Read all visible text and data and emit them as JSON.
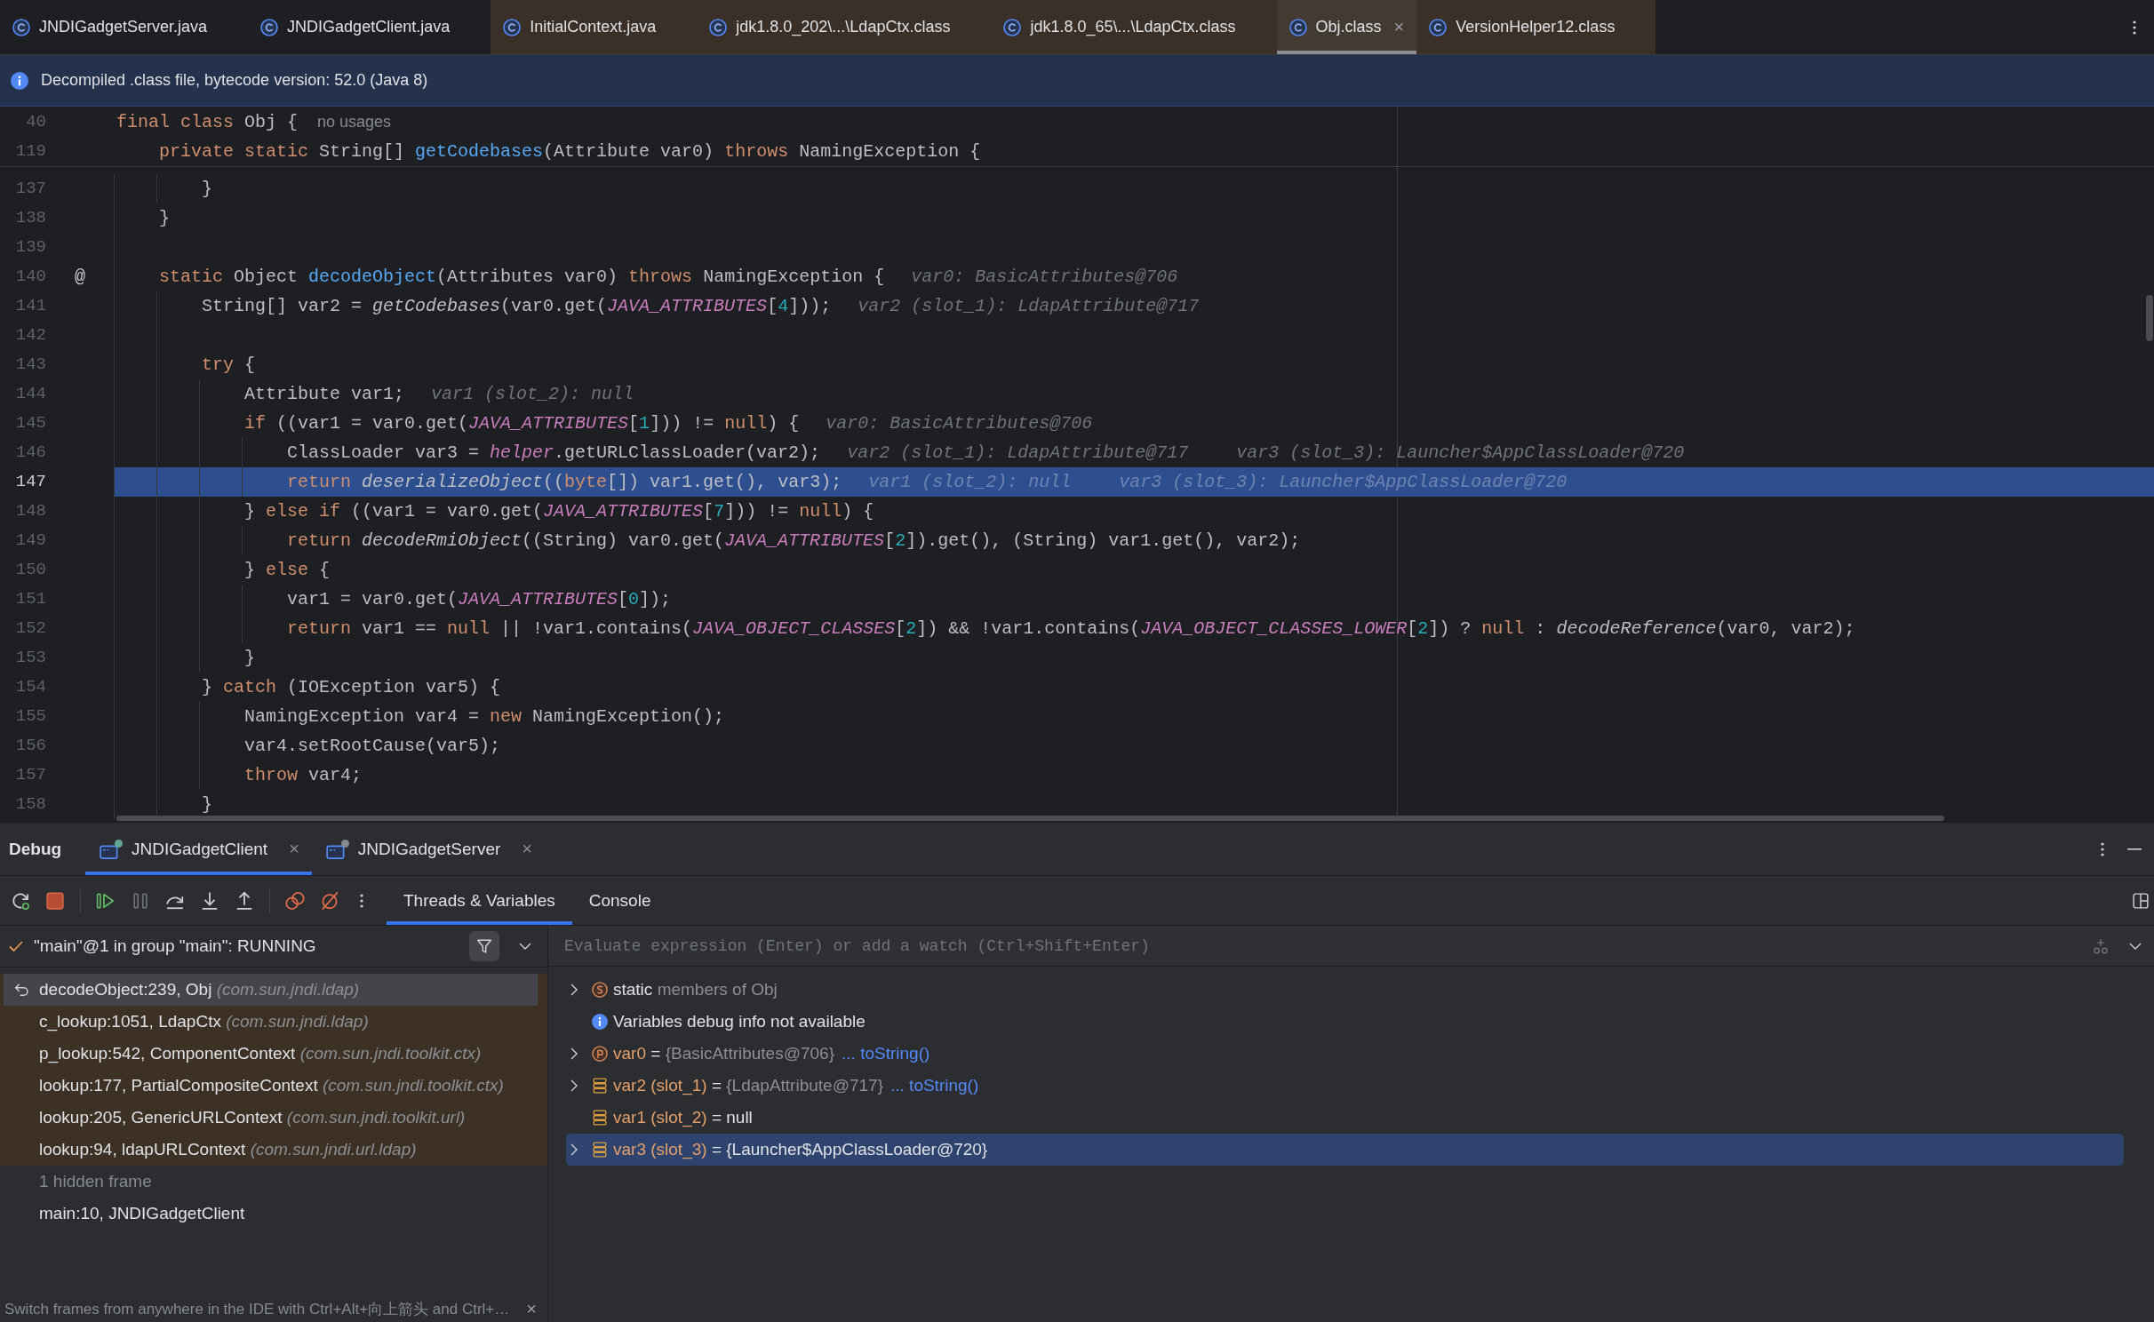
{
  "editor_tabs": [
    {
      "label": "JNDIGadgetServer.java",
      "library": false,
      "selected": false
    },
    {
      "label": "JNDIGadgetClient.java",
      "library": false,
      "selected": false
    },
    {
      "label": "InitialContext.java",
      "library": true,
      "selected": false
    },
    {
      "label": "jdk1.8.0_202\\...\\LdapCtx.class",
      "library": true,
      "selected": false
    },
    {
      "label": "jdk1.8.0_65\\...\\LdapCtx.class",
      "library": true,
      "selected": false
    },
    {
      "label": "Obj.class",
      "library": true,
      "selected": true,
      "close": "×"
    },
    {
      "label": "VersionHelper12.class",
      "library": true,
      "selected": false
    }
  ],
  "notification": {
    "text": "Decompiled .class file, bytecode version: 52.0 (Java 8)"
  },
  "editor": {
    "lines": [
      {
        "number": "40",
        "current": false,
        "tokens": [
          {
            "kind": "keyword",
            "text": "final class"
          },
          {
            "kind": "plain",
            "text": " Obj {"
          }
        ],
        "hints": [
          {
            "kind": "usages",
            "text": "no usages"
          }
        ],
        "children": [
          {
            "number": "119",
            "current": false,
            "tokens": [
              {
                "kind": "keyword",
                "text": "private static"
              },
              {
                "kind": "plain",
                "text": " String[] "
              },
              {
                "kind": "declaration",
                "text": "getCodebases"
              },
              {
                "kind": "plain",
                "text": "(Attribute var0) "
              },
              {
                "kind": "keyword",
                "text": "throws"
              },
              {
                "kind": "plain",
                "text": " NamingException {"
              }
            ],
            "children": [
              {
                "number": "137",
                "current": false,
                "tokens": [
                  {
                    "kind": "plain",
                    "text": "}"
                  }
                ]
              }
            ]
          },
          {
            "number": "138",
            "current": false,
            "tokens": [
              {
                "kind": "plain",
                "text": "}"
              }
            ]
          },
          {
            "number": "139",
            "current": false
          },
          {
            "number": "140",
            "current": false,
            "gutter_mark": "@",
            "tokens": [
              {
                "kind": "keyword",
                "text": "static"
              },
              {
                "kind": "plain",
                "text": " Object "
              },
              {
                "kind": "declaration",
                "text": "decodeObject"
              },
              {
                "kind": "plain",
                "text": "(Attributes var0) "
              },
              {
                "kind": "keyword",
                "text": "throws"
              },
              {
                "kind": "plain",
                "text": " NamingException {"
              }
            ],
            "hints": [
              {
                "kind": "value",
                "text": "var0: BasicAttributes@706"
              }
            ],
            "children": [
              {
                "number": "141",
                "current": false,
                "tokens": [
                  {
                    "kind": "plain",
                    "text": "String[] var2 = "
                  },
                  {
                    "kind": "static_call",
                    "text": "getCodebases"
                  },
                  {
                    "kind": "plain",
                    "text": "(var0.get("
                  },
                  {
                    "kind": "constant",
                    "text": "JAVA_ATTRIBUTES"
                  },
                  {
                    "kind": "plain",
                    "text": "["
                  },
                  {
                    "kind": "number",
                    "text": "4"
                  },
                  {
                    "kind": "plain",
                    "text": "]));"
                  }
                ],
                "hints": [
                  {
                    "kind": "value",
                    "text": "var2 (slot_1): LdapAttribute@717"
                  }
                ]
              },
              {
                "number": "142",
                "current": false
              },
              {
                "number": "143",
                "current": false,
                "tokens": [
                  {
                    "kind": "keyword",
                    "text": "try"
                  },
                  {
                    "kind": "plain",
                    "text": " {"
                  }
                ],
                "children": [
                  {
                    "number": "144",
                    "current": false,
                    "tokens": [
                      {
                        "kind": "plain",
                        "text": "Attribute var1;"
                      }
                    ],
                    "hints": [
                      {
                        "kind": "value",
                        "text": "var1 (slot_2): null"
                      }
                    ]
                  },
                  {
                    "number": "145",
                    "current": false,
                    "tokens": [
                      {
                        "kind": "keyword",
                        "text": "if"
                      },
                      {
                        "kind": "plain",
                        "text": " ((var1 = var0.get("
                      },
                      {
                        "kind": "constant",
                        "text": "JAVA_ATTRIBUTES"
                      },
                      {
                        "kind": "plain",
                        "text": "["
                      },
                      {
                        "kind": "number",
                        "text": "1"
                      },
                      {
                        "kind": "plain",
                        "text": "])) != "
                      },
                      {
                        "kind": "keyword",
                        "text": "null"
                      },
                      {
                        "kind": "plain",
                        "text": ") {"
                      }
                    ],
                    "hints": [
                      {
                        "kind": "value",
                        "text": "var0: BasicAttributes@706"
                      }
                    ],
                    "children": [
                      {
                        "number": "146",
                        "current": false,
                        "tokens": [
                          {
                            "kind": "plain",
                            "text": "ClassLoader var3 = "
                          },
                          {
                            "kind": "field",
                            "text": "helper"
                          },
                          {
                            "kind": "plain",
                            "text": ".getURLClassLoader(var2);"
                          }
                        ],
                        "hints": [
                          {
                            "kind": "value",
                            "text": "var2 (slot_1): LdapAttribute@717"
                          },
                          {
                            "kind": "value",
                            "text": "var3 (slot_3): Launcher$AppClassLoader@720"
                          }
                        ]
                      },
                      {
                        "number": "147",
                        "current": true,
                        "tokens": [
                          {
                            "kind": "keyword",
                            "text": "return "
                          },
                          {
                            "kind": "static_call",
                            "text": "deserializeObject"
                          },
                          {
                            "kind": "plain",
                            "text": "(("
                          },
                          {
                            "kind": "keyword",
                            "text": "byte"
                          },
                          {
                            "kind": "plain",
                            "text": "[]) var1.get(), var3);"
                          }
                        ],
                        "hints": [
                          {
                            "kind": "value",
                            "text": "var1 (slot_2): null"
                          },
                          {
                            "kind": "value",
                            "text": "var3 (slot_3): Launcher$AppClassLoader@720"
                          }
                        ]
                      }
                    ]
                  },
                  {
                    "number": "148",
                    "current": false,
                    "tokens": [
                      {
                        "kind": "plain",
                        "text": "} "
                      },
                      {
                        "kind": "keyword",
                        "text": "else if"
                      },
                      {
                        "kind": "plain",
                        "text": " ((var1 = var0.get("
                      },
                      {
                        "kind": "constant",
                        "text": "JAVA_ATTRIBUTES"
                      },
                      {
                        "kind": "plain",
                        "text": "["
                      },
                      {
                        "kind": "number",
                        "text": "7"
                      },
                      {
                        "kind": "plain",
                        "text": "])) != "
                      },
                      {
                        "kind": "keyword",
                        "text": "null"
                      },
                      {
                        "kind": "plain",
                        "text": ") {"
                      }
                    ],
                    "children": [
                      {
                        "number": "149",
                        "current": false,
                        "tokens": [
                          {
                            "kind": "keyword",
                            "text": "return "
                          },
                          {
                            "kind": "static_call",
                            "text": "decodeRmiObject"
                          },
                          {
                            "kind": "plain",
                            "text": "((String) var0.get("
                          },
                          {
                            "kind": "constant",
                            "text": "JAVA_ATTRIBUTES"
                          },
                          {
                            "kind": "plain",
                            "text": "["
                          },
                          {
                            "kind": "number",
                            "text": "2"
                          },
                          {
                            "kind": "plain",
                            "text": "]).get(), (String) var1.get(), var2);"
                          }
                        ]
                      }
                    ]
                  },
                  {
                    "number": "150",
                    "current": false,
                    "tokens": [
                      {
                        "kind": "plain",
                        "text": "} "
                      },
                      {
                        "kind": "keyword",
                        "text": "else"
                      },
                      {
                        "kind": "plain",
                        "text": " {"
                      }
                    ],
                    "children": [
                      {
                        "number": "151",
                        "current": false,
                        "tokens": [
                          {
                            "kind": "plain",
                            "text": "var1 = var0.get("
                          },
                          {
                            "kind": "constant",
                            "text": "JAVA_ATTRIBUTES"
                          },
                          {
                            "kind": "plain",
                            "text": "["
                          },
                          {
                            "kind": "number",
                            "text": "0"
                          },
                          {
                            "kind": "plain",
                            "text": "]);"
                          }
                        ]
                      },
                      {
                        "number": "152",
                        "current": false,
                        "tokens": [
                          {
                            "kind": "keyword",
                            "text": "return"
                          },
                          {
                            "kind": "plain",
                            "text": " var1 == "
                          },
                          {
                            "kind": "keyword",
                            "text": "null"
                          },
                          {
                            "kind": "plain",
                            "text": " || !var1.contains("
                          },
                          {
                            "kind": "constant",
                            "text": "JAVA_OBJECT_CLASSES"
                          },
                          {
                            "kind": "plain",
                            "text": "["
                          },
                          {
                            "kind": "number",
                            "text": "2"
                          },
                          {
                            "kind": "plain",
                            "text": "]) && !var1.contains("
                          },
                          {
                            "kind": "constant",
                            "text": "JAVA_OBJECT_CLASSES_LOWER"
                          },
                          {
                            "kind": "plain",
                            "text": "["
                          },
                          {
                            "kind": "number",
                            "text": "2"
                          },
                          {
                            "kind": "plain",
                            "text": "]) ? "
                          },
                          {
                            "kind": "keyword",
                            "text": "null"
                          },
                          {
                            "kind": "plain",
                            "text": " : "
                          },
                          {
                            "kind": "static_call",
                            "text": "decodeReference"
                          },
                          {
                            "kind": "plain",
                            "text": "(var0, var2);"
                          }
                        ]
                      }
                    ]
                  },
                  {
                    "number": "153",
                    "current": false,
                    "tokens": [
                      {
                        "kind": "plain",
                        "text": "}"
                      }
                    ]
                  }
                ]
              },
              {
                "number": "154",
                "current": false,
                "tokens": [
                  {
                    "kind": "plain",
                    "text": "} "
                  },
                  {
                    "kind": "keyword",
                    "text": "catch"
                  },
                  {
                    "kind": "plain",
                    "text": " (IOException var5) {"
                  }
                ],
                "children": [
                  {
                    "number": "155",
                    "current": false,
                    "tokens": [
                      {
                        "kind": "plain",
                        "text": "NamingException var4 = "
                      },
                      {
                        "kind": "keyword",
                        "text": "new"
                      },
                      {
                        "kind": "plain",
                        "text": " NamingException();"
                      }
                    ]
                  },
                  {
                    "number": "156",
                    "current": false,
                    "tokens": [
                      {
                        "kind": "plain",
                        "text": "var4.setRootCause(var5);"
                      }
                    ]
                  },
                  {
                    "number": "157",
                    "current": false,
                    "tokens": [
                      {
                        "kind": "keyword",
                        "text": "throw"
                      },
                      {
                        "kind": "plain",
                        "text": " var4;"
                      }
                    ]
                  }
                ]
              },
              {
                "number": "158",
                "current": false,
                "tokens": [
                  {
                    "kind": "plain",
                    "text": "}"
                  }
                ]
              }
            ]
          }
        ]
      }
    ]
  },
  "debug": {
    "title": "Debug",
    "sessions": [
      {
        "label": "JNDIGadgetClient",
        "selected": true,
        "color": "#5fa894",
        "close": "×"
      },
      {
        "label": "JNDIGadgetServer",
        "selected": false,
        "color": "#868a91",
        "close": "×"
      }
    ],
    "view_tabs": [
      {
        "label": "Threads & Variables",
        "selected": true
      },
      {
        "label": "Console",
        "selected": false
      }
    ],
    "thread": {
      "label": "\"main\"@1 in group \"main\": RUNNING"
    },
    "frames": [
      {
        "kind": "frame",
        "method": "decodeObject:239, Obj",
        "package": "(com.sun.jndi.ldap)",
        "library": true,
        "selected": true
      },
      {
        "kind": "frame",
        "method": "c_lookup:1051, LdapCtx",
        "package": "(com.sun.jndi.ldap)",
        "library": true,
        "selected": false
      },
      {
        "kind": "frame",
        "method": "p_lookup:542, ComponentContext",
        "package": "(com.sun.jndi.toolkit.ctx)",
        "library": true,
        "selected": false
      },
      {
        "kind": "frame",
        "method": "lookup:177, PartialCompositeContext",
        "package": "(com.sun.jndi.toolkit.ctx)",
        "library": true,
        "selected": false
      },
      {
        "kind": "frame",
        "method": "lookup:205, GenericURLContext",
        "package": "(com.sun.jndi.toolkit.url)",
        "library": true,
        "selected": false
      },
      {
        "kind": "frame",
        "method": "lookup:94, ldapURLContext",
        "package": "(com.sun.jndi.url.ldap)",
        "library": true,
        "selected": false
      },
      {
        "kind": "hidden",
        "method": "1 hidden frame",
        "library": false,
        "selected": false
      },
      {
        "kind": "frame",
        "method": "main:10, JNDIGadgetClient",
        "library": false,
        "selected": false
      }
    ],
    "frames_hint": {
      "text": "Switch frames from anywhere in the IDE with Ctrl+Alt+向上箭头 and Ctrl+…",
      "close": "×"
    },
    "evaluate": {
      "placeholder": "Evaluate expression (Enter) or add a watch (Ctrl+Shift+Enter)"
    },
    "variables": [
      {
        "kind": "static",
        "name": "static",
        "value": "members of Obj",
        "value_dimmed": true,
        "expandable": true,
        "selected": false
      },
      {
        "kind": "info",
        "name": "Variables debug info not available",
        "expandable": false,
        "selected": false
      },
      {
        "kind": "parameter",
        "name": "var0",
        "equals": "=",
        "value": "{BasicAttributes@706}",
        "value_dimmed": true,
        "link": "... toString()",
        "expandable": true,
        "selected": false
      },
      {
        "kind": "local",
        "name": "var2 (slot_1)",
        "equals": "=",
        "value": "{LdapAttribute@717}",
        "value_dimmed": true,
        "link": "... toString()",
        "expandable": true,
        "selected": false
      },
      {
        "kind": "local",
        "name": "var1 (slot_2)",
        "equals": "=",
        "value": "null",
        "value_dimmed": false,
        "expandable": false,
        "selected": false
      },
      {
        "kind": "local",
        "name": "var3 (slot_3)",
        "equals": "=",
        "value": "{Launcher$AppClassLoader@720}",
        "value_dimmed": false,
        "expandable": true,
        "selected": true
      }
    ]
  }
}
